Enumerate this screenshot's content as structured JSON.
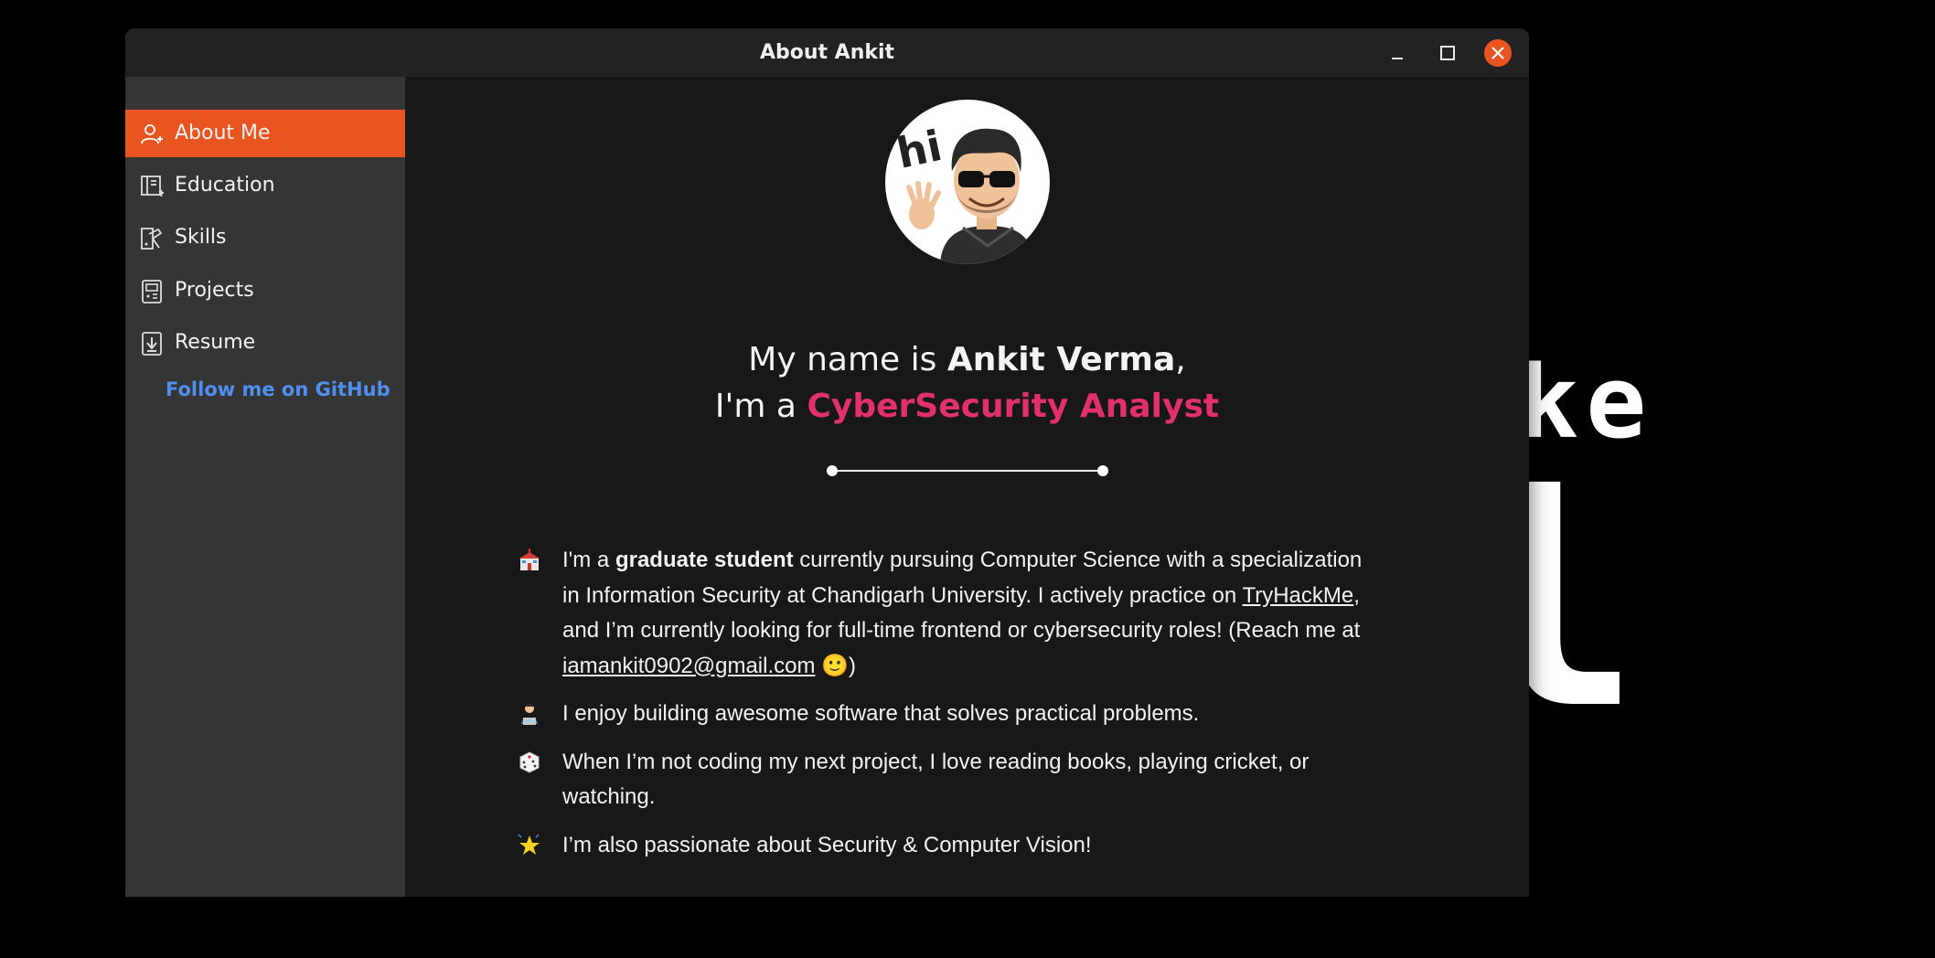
{
  "window": {
    "title": "About Ankit"
  },
  "sidebar": {
    "items": [
      {
        "label": "About Me",
        "icon": "user-plus-icon",
        "active": true
      },
      {
        "label": "Education",
        "icon": "book-icon",
        "active": false
      },
      {
        "label": "Skills",
        "icon": "tools-icon",
        "active": false
      },
      {
        "label": "Projects",
        "icon": "device-icon",
        "active": false
      },
      {
        "label": "Resume",
        "icon": "download-icon",
        "active": false
      }
    ],
    "github_link": "Follow me on GitHub"
  },
  "main": {
    "avatar_text": "hi",
    "heading_line1_prefix": "My name is",
    "heading_name": "Ankit Verma",
    "heading_line1_suffix": ",",
    "heading_line2_prefix": "I'm a",
    "heading_role": "CyberSecurity Analyst",
    "bullets": [
      {
        "icon": "school-icon",
        "pre": "I'm a",
        "bold": "graduate student",
        "mid": "currently pursuing Computer Science with a specialization in Information Security at Chandigarh University. I actively practice on",
        "link1": "TryHackMe",
        "mid2": ", and I’m currently looking for full-time frontend or cybersecurity roles! (Reach me at",
        "link2": "iamankit0902@gmail.com",
        "post": "🙂)"
      },
      {
        "icon": "technologist-icon",
        "text": "I enjoy building awesome software that solves practical problems."
      },
      {
        "icon": "die-icon",
        "text": "When I’m not coding my next project, I love reading books, playing cricket, or watching."
      },
      {
        "icon": "star-icon",
        "text": "I’m also passionate about Security & Computer Vision!"
      }
    ]
  },
  "wallpaper": {
    "text_top": "ke",
    "text_big": "l"
  },
  "colors": {
    "accent": "#e95420",
    "role": "#e1306c",
    "link": "#4f8ff0",
    "sidebar_bg": "#353535",
    "main_bg": "#181818"
  }
}
